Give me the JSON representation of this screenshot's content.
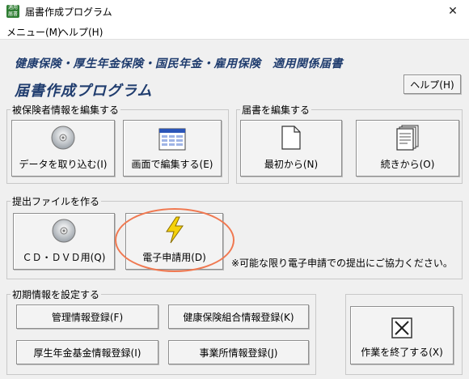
{
  "window": {
    "icon_text": "適用\n届書",
    "title": "届書作成プログラム",
    "close_glyph": "✕"
  },
  "menu": {
    "items": [
      "メニュー(M)",
      "ヘルプ(H)"
    ]
  },
  "header": {
    "subtitle": "健康保険・厚生年金保険・国民年金・雇用保険　適用関係届書",
    "title": "届書作成プログラム",
    "help_button": "ヘルプ(H)"
  },
  "groups": {
    "insured": {
      "label": "被保険者情報を編集する",
      "import_button": "データを取り込む(I)",
      "screen_edit_button": "画面で編集する(E)"
    },
    "notification": {
      "label": "届書を編集する",
      "new_button": "最初から(N)",
      "continue_button": "続きから(O)"
    },
    "submission": {
      "label": "提出ファイルを作る",
      "cd_dvd_button": "ＣＤ・ＤＶＤ用(Q)",
      "electronic_button": "電子申請用(D)",
      "note": "※可能な限り電子申請での提出にご協力ください。"
    },
    "initial": {
      "label": "初期情報を設定する",
      "management_button": "管理情報登録(F)",
      "health_union_button": "健康保険組合情報登録(K)",
      "pension_fund_button": "厚生年金基金情報登録(I)",
      "office_button": "事業所情報登録(J)"
    }
  },
  "exit_button": "作業を終了する(X)",
  "colors": {
    "header_text": "#1f3c6e",
    "highlight": "#f07850",
    "bolt": "#f5d20a"
  }
}
